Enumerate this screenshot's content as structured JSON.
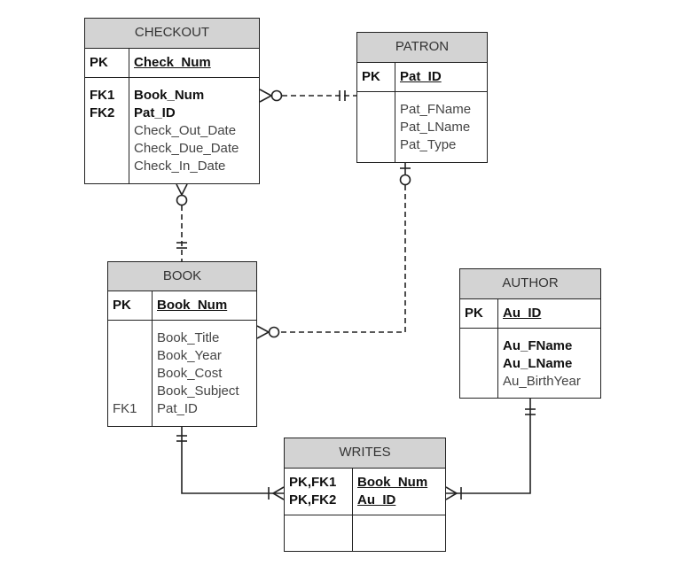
{
  "entities": [
    {
      "id": "checkout",
      "title": "CHECKOUT",
      "sections": [
        {
          "rows": [
            {
              "key": "PK",
              "name": "Check_Num",
              "bold": true,
              "underline": true
            }
          ]
        },
        {
          "rows": [
            {
              "key": "FK1",
              "name": "Book_Num",
              "bold": true
            },
            {
              "key": "FK2",
              "name": "Pat_ID",
              "bold": true
            },
            {
              "key": "",
              "name": "Check_Out_Date"
            },
            {
              "key": "",
              "name": "Check_Due_Date"
            },
            {
              "key": "",
              "name": "Check_In_Date"
            }
          ]
        }
      ]
    },
    {
      "id": "patron",
      "title": "PATRON",
      "sections": [
        {
          "rows": [
            {
              "key": "PK",
              "name": "Pat_ID",
              "bold": true,
              "underline": true
            }
          ]
        },
        {
          "rows": [
            {
              "key": "",
              "name": "Pat_FName"
            },
            {
              "key": "",
              "name": "Pat_LName"
            },
            {
              "key": "",
              "name": "Pat_Type"
            }
          ]
        }
      ]
    },
    {
      "id": "book",
      "title": "BOOK",
      "sections": [
        {
          "rows": [
            {
              "key": "PK",
              "name": "Book_Num",
              "bold": true,
              "underline": true
            }
          ]
        },
        {
          "rows": [
            {
              "key": "",
              "name": "Book_Title"
            },
            {
              "key": "",
              "name": "Book_Year"
            },
            {
              "key": "",
              "name": "Book_Cost"
            },
            {
              "key": "",
              "name": "Book_Subject"
            },
            {
              "key": "FK1",
              "name": "Pat_ID",
              "keyPlain": true
            }
          ]
        }
      ]
    },
    {
      "id": "author",
      "title": "AUTHOR",
      "sections": [
        {
          "rows": [
            {
              "key": "PK",
              "name": "Au_ID",
              "bold": true,
              "underline": true
            }
          ]
        },
        {
          "rows": [
            {
              "key": "",
              "name": "Au_FName",
              "bold": true
            },
            {
              "key": "",
              "name": "Au_LName",
              "bold": true
            },
            {
              "key": "",
              "name": "Au_BirthYear"
            }
          ]
        }
      ]
    },
    {
      "id": "writes",
      "title": "WRITES",
      "sections": [
        {
          "rows": [
            {
              "key": "PK,FK1",
              "name": "Book_Num",
              "bold": true,
              "underline": true
            },
            {
              "key": "PK,FK2",
              "name": "Au_ID",
              "bold": true,
              "underline": true
            }
          ]
        },
        {
          "rows": []
        }
      ]
    }
  ],
  "relationships": [
    {
      "from": "CHECKOUT",
      "to": "PATRON",
      "from_card": "zero-or-many",
      "to_card": "one-and-only-one",
      "style": "dashed"
    },
    {
      "from": "CHECKOUT",
      "to": "BOOK",
      "from_card": "zero-or-many",
      "to_card": "one-and-only-one",
      "style": "dashed"
    },
    {
      "from": "BOOK",
      "to": "PATRON",
      "from_card": "zero-or-many",
      "to_card": "zero-or-one",
      "style": "dashed"
    },
    {
      "from": "WRITES",
      "to": "BOOK",
      "from_card": "one-or-many",
      "to_card": "one-and-only-one",
      "style": "solid"
    },
    {
      "from": "WRITES",
      "to": "AUTHOR",
      "from_card": "one-or-many",
      "to_card": "one-and-only-one",
      "style": "solid"
    }
  ],
  "colors": {
    "header_bg": "#d3d3d3",
    "line": "#222222"
  }
}
